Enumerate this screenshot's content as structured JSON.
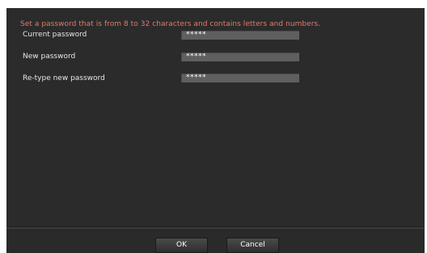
{
  "notice": "Set a password that is from 8 to 32 characters and contains letters and numbers.",
  "fields": [
    {
      "label": "Current password",
      "value": "*****"
    },
    {
      "label": "New password",
      "value": "*****"
    },
    {
      "label": "Re-type new password",
      "value": "*****"
    }
  ],
  "buttons": {
    "ok": "OK",
    "cancel": "Cancel"
  },
  "colors": {
    "notice": "#e07a6c",
    "background": "#2b2b2b",
    "field": "#5f5f5f"
  }
}
